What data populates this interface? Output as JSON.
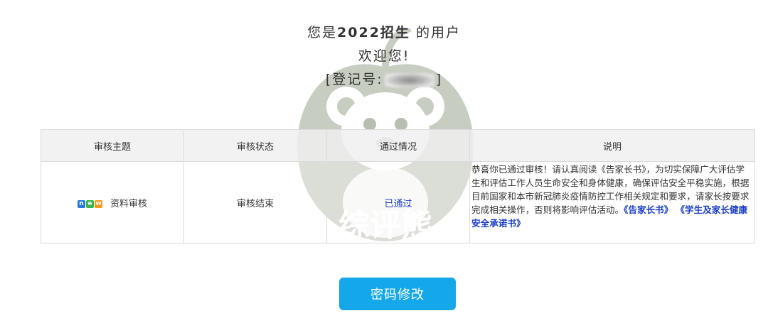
{
  "welcome": {
    "prefix": "您是",
    "org": "2022招生",
    "suffix": " 的用户",
    "greeting": "欢迎您!",
    "reg_open": "[登记号:",
    "reg_close": "]"
  },
  "watermark": {
    "text": "综评熊"
  },
  "table": {
    "headers": [
      "审核主题",
      "审核状态",
      "通过情况",
      "说明"
    ],
    "row": {
      "badge_letters": [
        "n",
        "e",
        "w"
      ],
      "badge_colors": [
        "#2a7ad8",
        "#3ab54a",
        "#f39a1e"
      ],
      "topic": "资料审核",
      "status": "审核结束",
      "result": "已通过",
      "description": "恭喜你已通过审核！请认真阅读《告家长书》，为切实保障广大评估学生和评估工作人员生命安全和身体健康，确保评估安全平稳实施，根据目前国家和本市新冠肺炎疫情防控工作相关规定和要求，请家长按要求完成相关操作，否则将影响评估活动。",
      "link1": "《告家长书》",
      "link2": "《学生及家长健康安全承诺书》"
    }
  },
  "button": {
    "label": "密码修改"
  },
  "colors": {
    "primary": "#14a7ea",
    "link": "#1a3ec8",
    "watermark": "#8a9a7a"
  }
}
